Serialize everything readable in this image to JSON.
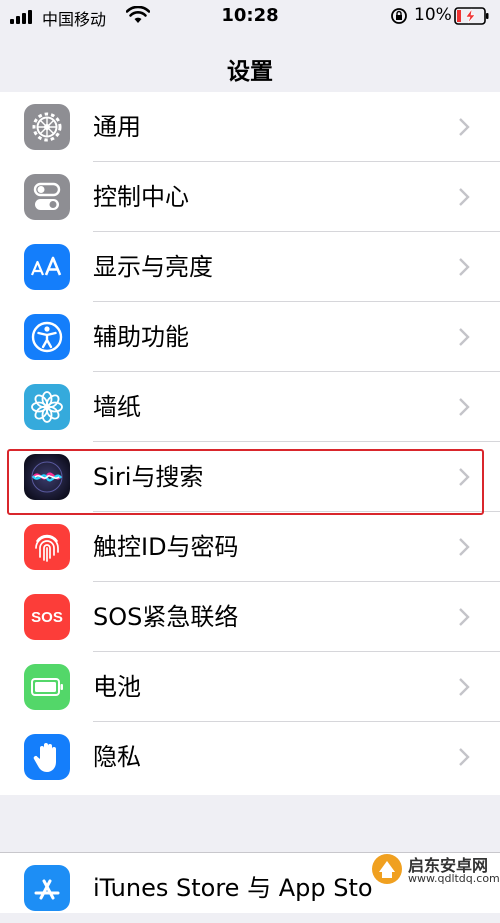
{
  "status_bar": {
    "carrier": "中国移动",
    "time": "10:28",
    "battery_percent": "10%"
  },
  "nav": {
    "title": "设置"
  },
  "settings_items": [
    {
      "label": "通用",
      "icon": "gear-icon",
      "color": "#8e8e93"
    },
    {
      "label": "控制中心",
      "icon": "toggles-icon",
      "color": "#8e8e93"
    },
    {
      "label": "显示与亮度",
      "icon": "text-size-icon",
      "color": "#147efb"
    },
    {
      "label": "辅助功能",
      "icon": "accessibility-icon",
      "color": "#147efb"
    },
    {
      "label": "墙纸",
      "icon": "flower-icon",
      "color": "#35aadc"
    },
    {
      "label": "Siri与搜索",
      "icon": "siri-icon",
      "color": "#1c1c3a"
    },
    {
      "label": "触控ID与密码",
      "icon": "fingerprint-icon",
      "color": "#fc3d39"
    },
    {
      "label": "SOS紧急联络",
      "icon": "sos-icon",
      "color": "#fc3d39",
      "icon_text": "SOS"
    },
    {
      "label": "电池",
      "icon": "battery-icon",
      "color": "#53d769"
    },
    {
      "label": "隐私",
      "icon": "hand-icon",
      "color": "#147efb"
    }
  ],
  "settings_items_2": [
    {
      "label": "iTunes Store 与 App Sto",
      "icon": "app-store-icon",
      "color": "#1d8ef5"
    }
  ],
  "highlighted_item": "Siri与搜索",
  "watermark": {
    "text": "启东安卓网",
    "url": "www.qdltdq.com"
  }
}
